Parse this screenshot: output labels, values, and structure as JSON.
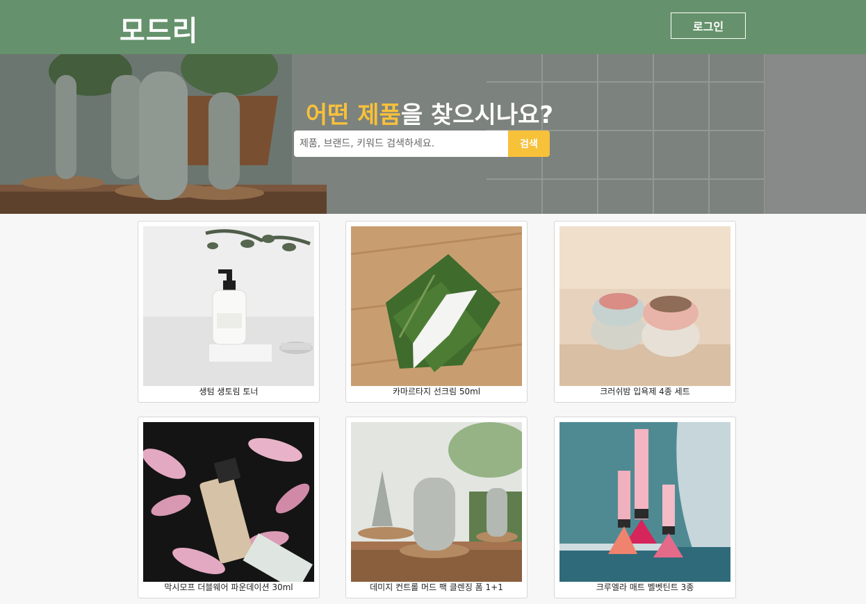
{
  "header": {
    "logo": "모드리",
    "login_label": "로그인"
  },
  "hero": {
    "title_highlight": "어떤 제품",
    "title_rest": "을 찾으시나요?",
    "search_placeholder": "제품, 브랜드, 키워드 검색하세요.",
    "search_button": "검색"
  },
  "products": [
    {
      "name": "생텀 생토림 토너"
    },
    {
      "name": "카마르타지 선크림 50ml"
    },
    {
      "name": "크러쉬밤 입욕제 4종 세트"
    },
    {
      "name": "막시모프 더블웨어 파운데이션 30ml"
    },
    {
      "name": "데미지 컨트롤 머드 팩 클렌징 폼 1+1"
    },
    {
      "name": "크루엘라 매트 벨벳틴트 3종"
    }
  ],
  "colors": {
    "header_bg": "#65926c",
    "accent": "#f8c13a"
  }
}
